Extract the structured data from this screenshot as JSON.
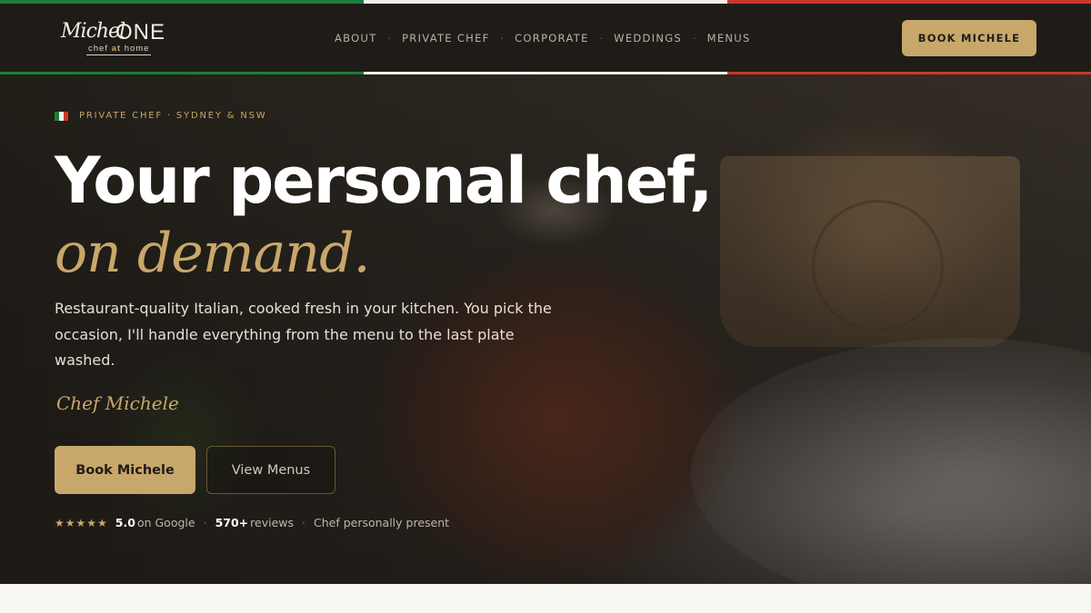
{
  "colors": {
    "green": "#1e7c3a",
    "white": "#f2efe9",
    "red": "#c9382a",
    "gold": "#c8a76b",
    "dark": "#1f1c18"
  },
  "brand": {
    "name_script": "Michel",
    "name_one": "ONE",
    "tag_pre": "chef ",
    "tag_at": "at",
    "tag_post": " home"
  },
  "nav": {
    "items": [
      {
        "label": "ABOUT"
      },
      {
        "label": "PRIVATE CHEF"
      },
      {
        "label": "CORPORATE"
      },
      {
        "label": "WEDDINGS"
      },
      {
        "label": "MENUS"
      }
    ],
    "separator": "·",
    "book_label": "BOOK MICHELE"
  },
  "hero": {
    "eyebrow": "PRIVATE CHEF · SYDNEY & NSW",
    "headline": "Your personal chef,",
    "headline_accent": "on demand.",
    "lede": "Restaurant-quality Italian, cooked fresh in your kitchen. You pick the occasion, I'll handle everything from the menu to the last plate washed.",
    "signature": "Chef Michele",
    "primary_cta": "Book Michele",
    "secondary_cta": "View Menus"
  },
  "proof": {
    "stars": "★★★★★",
    "rating": "5.0",
    "rating_suffix": "on Google",
    "reviews_count": "570+",
    "reviews_suffix": " reviews",
    "note": "Chef personally present",
    "separator": "·"
  }
}
